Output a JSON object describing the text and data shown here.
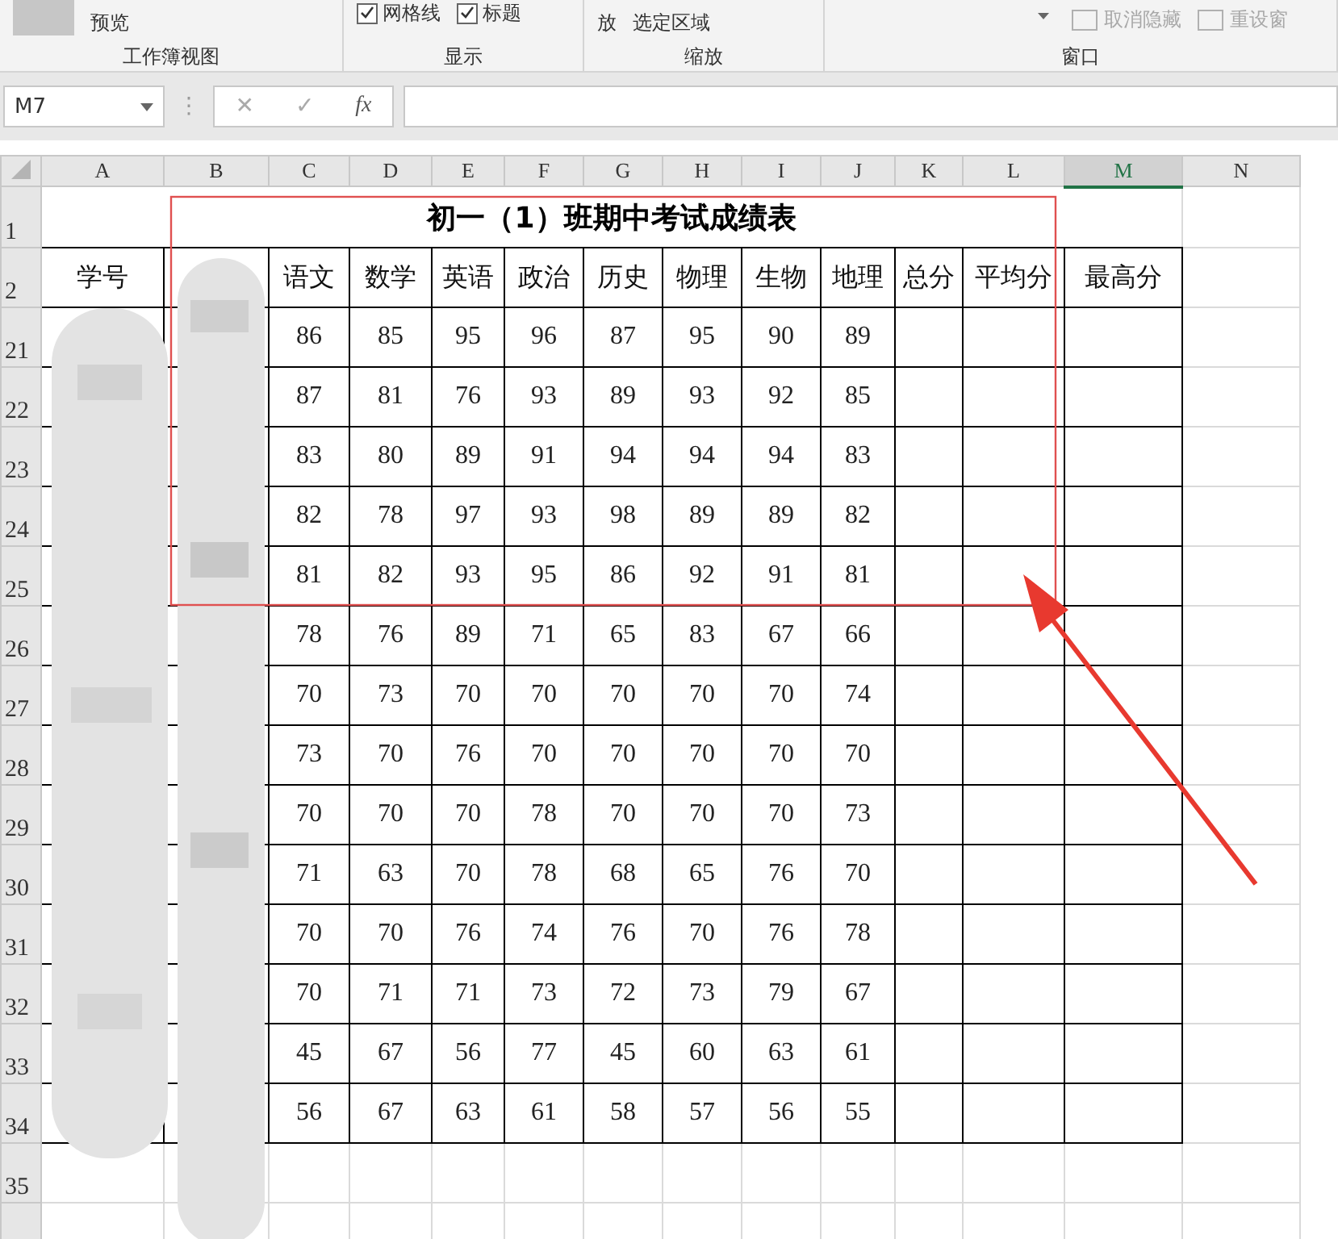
{
  "ribbon": {
    "groups": [
      {
        "label": "工作簿视图",
        "items": [
          {
            "kind": "pressed",
            "selected": true
          },
          {
            "kind": "text",
            "label": "预览"
          }
        ]
      },
      {
        "label": "显示",
        "items": [
          {
            "kind": "checkbox",
            "label": "网格线",
            "checked": true
          },
          {
            "kind": "checkbox",
            "label": "标题",
            "checked": true
          }
        ]
      },
      {
        "label": "缩放",
        "items": [
          {
            "kind": "text",
            "label": "放"
          },
          {
            "kind": "text",
            "label": "选定区域"
          }
        ]
      },
      {
        "label": "窗口",
        "items": [
          {
            "kind": "caret"
          },
          {
            "kind": "disabled",
            "label": "取消隐藏"
          },
          {
            "kind": "disabled",
            "label": "重设窗"
          }
        ]
      }
    ]
  },
  "formula_bar": {
    "name_box": "M7",
    "grip": "⋮",
    "cancel": "✕",
    "enter": "✓",
    "function": "fx"
  },
  "sheet": {
    "columns": [
      {
        "letter": "A",
        "selected": false
      },
      {
        "letter": "B",
        "selected": false
      },
      {
        "letter": "C",
        "selected": false
      },
      {
        "letter": "D",
        "selected": false
      },
      {
        "letter": "E",
        "selected": false
      },
      {
        "letter": "F",
        "selected": false
      },
      {
        "letter": "G",
        "selected": false
      },
      {
        "letter": "H",
        "selected": false
      },
      {
        "letter": "I",
        "selected": false
      },
      {
        "letter": "J",
        "selected": false
      },
      {
        "letter": "K",
        "selected": false
      },
      {
        "letter": "L",
        "selected": false
      },
      {
        "letter": "M",
        "selected": true
      },
      {
        "letter": "N",
        "selected": false
      }
    ],
    "title_row": {
      "number": "1",
      "title": "初一（1）班期中考试成绩表"
    },
    "header_row": {
      "number": "2",
      "id_header": "学号",
      "subject_headers": [
        "语文",
        "数学",
        "英语",
        "政治",
        "历史",
        "物理",
        "生物",
        "地理",
        "总分",
        "平均分",
        "最高分"
      ]
    },
    "rows": [
      {
        "number": "21",
        "scores": [
          "86",
          "85",
          "95",
          "96",
          "87",
          "95",
          "90",
          "89"
        ]
      },
      {
        "number": "22",
        "scores": [
          "87",
          "81",
          "76",
          "93",
          "89",
          "93",
          "92",
          "85"
        ]
      },
      {
        "number": "23",
        "scores": [
          "83",
          "80",
          "89",
          "91",
          "94",
          "94",
          "94",
          "83"
        ]
      },
      {
        "number": "24",
        "scores": [
          "82",
          "78",
          "97",
          "93",
          "98",
          "89",
          "89",
          "82"
        ]
      },
      {
        "number": "25",
        "scores": [
          "81",
          "82",
          "93",
          "95",
          "86",
          "92",
          "91",
          "81"
        ]
      },
      {
        "number": "26",
        "scores": [
          "78",
          "76",
          "89",
          "71",
          "65",
          "83",
          "67",
          "66"
        ]
      },
      {
        "number": "27",
        "scores": [
          "70",
          "73",
          "70",
          "70",
          "70",
          "70",
          "70",
          "74"
        ]
      },
      {
        "number": "28",
        "scores": [
          "73",
          "70",
          "76",
          "70",
          "70",
          "70",
          "70",
          "70"
        ]
      },
      {
        "number": "29",
        "scores": [
          "70",
          "70",
          "70",
          "78",
          "70",
          "70",
          "70",
          "73"
        ]
      },
      {
        "number": "30",
        "scores": [
          "71",
          "63",
          "70",
          "78",
          "68",
          "65",
          "76",
          "70"
        ]
      },
      {
        "number": "31",
        "scores": [
          "70",
          "70",
          "76",
          "74",
          "76",
          "70",
          "76",
          "78"
        ]
      },
      {
        "number": "32",
        "scores": [
          "70",
          "71",
          "71",
          "73",
          "72",
          "73",
          "79",
          "67"
        ]
      },
      {
        "number": "33",
        "scores": [
          "45",
          "67",
          "56",
          "77",
          "45",
          "60",
          "63",
          "61"
        ]
      },
      {
        "number": "34",
        "scores": [
          "56",
          "67",
          "63",
          "61",
          "58",
          "57",
          "56",
          "55"
        ]
      }
    ],
    "empty_rows": [
      {
        "number": "35"
      }
    ]
  }
}
